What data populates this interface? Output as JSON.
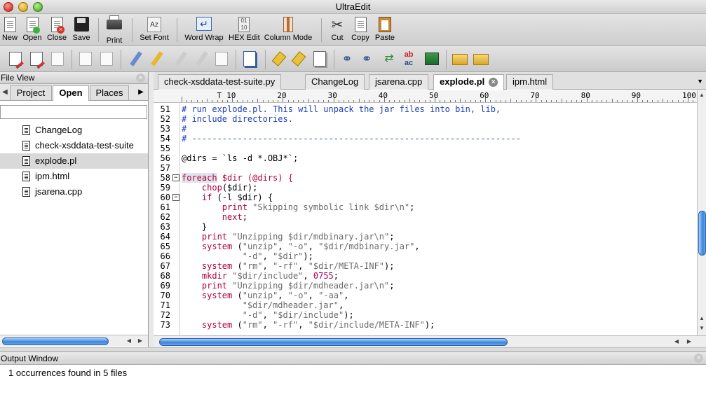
{
  "window": {
    "title": "UltraEdit"
  },
  "toolbar": {
    "buttons": [
      {
        "id": "new",
        "label": "New",
        "icon": "new-file-icon"
      },
      {
        "id": "open",
        "label": "Open",
        "icon": "open-file-icon"
      },
      {
        "id": "close",
        "label": "Close",
        "icon": "close-file-icon"
      },
      {
        "id": "save",
        "label": "Save",
        "icon": "floppy-disk-icon"
      },
      {
        "id": "print",
        "label": "Print",
        "icon": "printer-icon"
      },
      {
        "id": "setfont",
        "label": "Set Font",
        "icon": "font-icon"
      },
      {
        "id": "wordwrap",
        "label": "Word Wrap",
        "icon": "word-wrap-icon"
      },
      {
        "id": "hexedit",
        "label": "HEX Edit",
        "icon": "hex-edit-icon"
      },
      {
        "id": "columnmode",
        "label": "Column Mode",
        "icon": "column-mode-icon"
      },
      {
        "id": "cut",
        "label": "Cut",
        "icon": "scissors-icon"
      },
      {
        "id": "copy",
        "label": "Copy",
        "icon": "copy-icon"
      },
      {
        "id": "paste",
        "label": "Paste",
        "icon": "clipboard-icon"
      }
    ]
  },
  "file_view": {
    "title": "File View",
    "tabs": [
      "Project",
      "Open",
      "Places"
    ],
    "active_tab": "Open",
    "files": [
      "ChangeLog",
      "check-xsddata-test-suite",
      "explode.pl",
      "ipm.html",
      "jsarena.cpp"
    ],
    "selected": "explode.pl"
  },
  "editor": {
    "tabs": [
      "check-xsddata-test-suite.py",
      "ChangeLog",
      "jsarena.cpp",
      "explode.pl",
      "ipm.html"
    ],
    "active_tab": "explode.pl",
    "close_glyph": "×",
    "ruler_numbers": [
      "10",
      "20",
      "30",
      "40",
      "50",
      "60",
      "70",
      "80",
      "90",
      "100"
    ],
    "ruler_cursor_mark": "T",
    "lines": [
      {
        "n": "51",
        "fold": "",
        "segs": [
          [
            "c-com",
            "# run explode.pl. This will unpack the jar files into bin, lib,"
          ]
        ]
      },
      {
        "n": "52",
        "fold": "",
        "segs": [
          [
            "c-com",
            "# include directories."
          ]
        ]
      },
      {
        "n": "53",
        "fold": "",
        "segs": [
          [
            "c-com",
            "#"
          ]
        ]
      },
      {
        "n": "54",
        "fold": "",
        "segs": [
          [
            "c-com",
            "# -----------------------------------------------------------------"
          ]
        ]
      },
      {
        "n": "55",
        "fold": "",
        "segs": []
      },
      {
        "n": "56",
        "fold": "",
        "segs": [
          [
            "",
            "@dirs = `ls -d *.OBJ*`;"
          ]
        ]
      },
      {
        "n": "57",
        "fold": "",
        "segs": []
      },
      {
        "n": "58",
        "fold": "−",
        "segs": [
          [
            "c-kw c-hl",
            "foreach"
          ],
          [
            "",
            " "
          ],
          [
            "c-kw",
            "$dir (@dirs) {"
          ]
        ]
      },
      {
        "n": "59",
        "fold": "",
        "segs": [
          [
            "",
            "    "
          ],
          [
            "c-kw",
            "chop"
          ],
          [
            "",
            "($dir);"
          ]
        ]
      },
      {
        "n": "60",
        "fold": "−",
        "segs": [
          [
            "",
            "    "
          ],
          [
            "c-kw",
            "if"
          ],
          [
            "",
            " (-l $dir) {"
          ]
        ]
      },
      {
        "n": "61",
        "fold": "",
        "segs": [
          [
            "",
            "        "
          ],
          [
            "c-kw",
            "print"
          ],
          [
            "",
            " "
          ],
          [
            "c-str",
            "\"Skipping symbolic link $dir\\n\""
          ],
          [
            "",
            ";"
          ]
        ]
      },
      {
        "n": "62",
        "fold": "",
        "segs": [
          [
            "",
            "        "
          ],
          [
            "c-kw",
            "next"
          ],
          [
            "",
            ";"
          ]
        ]
      },
      {
        "n": "63",
        "fold": "",
        "segs": [
          [
            "",
            "    }"
          ]
        ]
      },
      {
        "n": "64",
        "fold": "",
        "segs": [
          [
            "",
            "    "
          ],
          [
            "c-kw",
            "print"
          ],
          [
            "",
            " "
          ],
          [
            "c-str",
            "\"Unzipping $dir/mdbinary.jar\\n\""
          ],
          [
            "",
            ";"
          ]
        ]
      },
      {
        "n": "65",
        "fold": "",
        "segs": [
          [
            "",
            "    "
          ],
          [
            "c-kw",
            "system"
          ],
          [
            "",
            " ("
          ],
          [
            "c-str",
            "\"unzip\""
          ],
          [
            "",
            ", "
          ],
          [
            "c-str",
            "\"-o\""
          ],
          [
            "",
            ", "
          ],
          [
            "c-str",
            "\"$dir/mdbinary.jar\""
          ],
          [
            "",
            ","
          ]
        ]
      },
      {
        "n": "66",
        "fold": "",
        "segs": [
          [
            "",
            "            "
          ],
          [
            "c-str",
            "\"-d\""
          ],
          [
            "",
            ", "
          ],
          [
            "c-str",
            "\"$dir\""
          ],
          [
            "",
            ");"
          ]
        ]
      },
      {
        "n": "67",
        "fold": "",
        "segs": [
          [
            "",
            "    "
          ],
          [
            "c-kw",
            "system"
          ],
          [
            "",
            " ("
          ],
          [
            "c-str",
            "\"rm\""
          ],
          [
            "",
            ", "
          ],
          [
            "c-str",
            "\"-rf\""
          ],
          [
            "",
            ", "
          ],
          [
            "c-str",
            "\"$dir/META-INF\""
          ],
          [
            "",
            ");"
          ]
        ]
      },
      {
        "n": "68",
        "fold": "",
        "segs": [
          [
            "",
            "    "
          ],
          [
            "c-kw",
            "mkdir"
          ],
          [
            "",
            " "
          ],
          [
            "c-str",
            "\"$dir/include\""
          ],
          [
            "",
            ", "
          ],
          [
            "c-num",
            "0755"
          ],
          [
            "",
            ";"
          ]
        ]
      },
      {
        "n": "69",
        "fold": "",
        "segs": [
          [
            "",
            "    "
          ],
          [
            "c-kw",
            "print"
          ],
          [
            "",
            " "
          ],
          [
            "c-str",
            "\"Unzipping $dir/mdheader.jar\\n\""
          ],
          [
            "",
            ";"
          ]
        ]
      },
      {
        "n": "70",
        "fold": "",
        "segs": [
          [
            "",
            "    "
          ],
          [
            "c-kw",
            "system"
          ],
          [
            "",
            " ("
          ],
          [
            "c-str",
            "\"unzip\""
          ],
          [
            "",
            ", "
          ],
          [
            "c-str",
            "\"-o\""
          ],
          [
            "",
            ", "
          ],
          [
            "c-str",
            "\"-aa\""
          ],
          [
            "",
            ","
          ]
        ]
      },
      {
        "n": "71",
        "fold": "",
        "segs": [
          [
            "",
            "            "
          ],
          [
            "c-str",
            "\"$dir/mdheader.jar\""
          ],
          [
            "",
            ","
          ]
        ]
      },
      {
        "n": "72",
        "fold": "",
        "segs": [
          [
            "",
            "            "
          ],
          [
            "c-str",
            "\"-d\""
          ],
          [
            "",
            ", "
          ],
          [
            "c-str",
            "\"$dir/include\""
          ],
          [
            "",
            ");"
          ]
        ]
      },
      {
        "n": "73",
        "fold": "",
        "segs": [
          [
            "",
            "    "
          ],
          [
            "c-kw",
            "system"
          ],
          [
            "",
            " ("
          ],
          [
            "c-str",
            "\"rm\""
          ],
          [
            "",
            ", "
          ],
          [
            "c-str",
            "\"-rf\""
          ],
          [
            "",
            ", "
          ],
          [
            "c-str",
            "\"$dir/include/META-INF\""
          ],
          [
            "",
            ");"
          ]
        ]
      }
    ]
  },
  "output": {
    "title": "Output Window",
    "text": "1 occurrences found  in 5 files"
  },
  "colors": {
    "comment": "#1e3fbf",
    "keyword": "#b0003a",
    "string": "#6a6a6a",
    "number": "#a8005a",
    "selection": "#3a84da"
  }
}
